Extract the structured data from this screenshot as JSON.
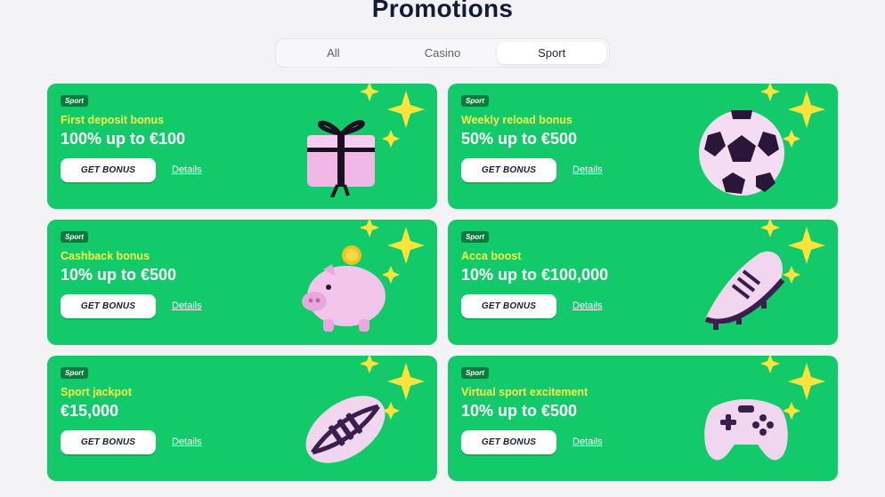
{
  "page": {
    "title": "Promotions"
  },
  "tabs": [
    {
      "label": "All",
      "active": false
    },
    {
      "label": "Casino",
      "active": false
    },
    {
      "label": "Sport",
      "active": true
    }
  ],
  "promotions": [
    {
      "badge": "Sport",
      "title": "First deposit bonus",
      "amount": "100% up to €100",
      "button": "GET BONUS",
      "details": "Details",
      "image": "gift-box-icon"
    },
    {
      "badge": "Sport",
      "title": "Weekly reload bonus",
      "amount": "50% up to €500",
      "button": "GET BONUS",
      "details": "Details",
      "image": "soccer-ball-icon"
    },
    {
      "badge": "Sport",
      "title": "Cashback bonus",
      "amount": "10% up to €500",
      "button": "GET BONUS",
      "details": "Details",
      "image": "piggy-bank-icon"
    },
    {
      "badge": "Sport",
      "title": "Acca boost",
      "amount": "10% up to €100,000",
      "button": "GET BONUS",
      "details": "Details",
      "image": "football-boot-icon"
    },
    {
      "badge": "Sport",
      "title": "Sport jackpot",
      "amount": "€15,000",
      "button": "GET BONUS",
      "details": "Details",
      "image": "rugby-ball-icon"
    },
    {
      "badge": "Sport",
      "title": "Virtual sport excitement",
      "amount": "10% up to €500",
      "button": "GET BONUS",
      "details": "Details",
      "image": "gamepad-icon"
    }
  ],
  "colors": {
    "card_background": "#12ca6a",
    "title_yellow": "#f4f24a",
    "badge_background": "#0a7a3e",
    "page_background": "#f3f3f6",
    "heading": "#141a3d"
  }
}
